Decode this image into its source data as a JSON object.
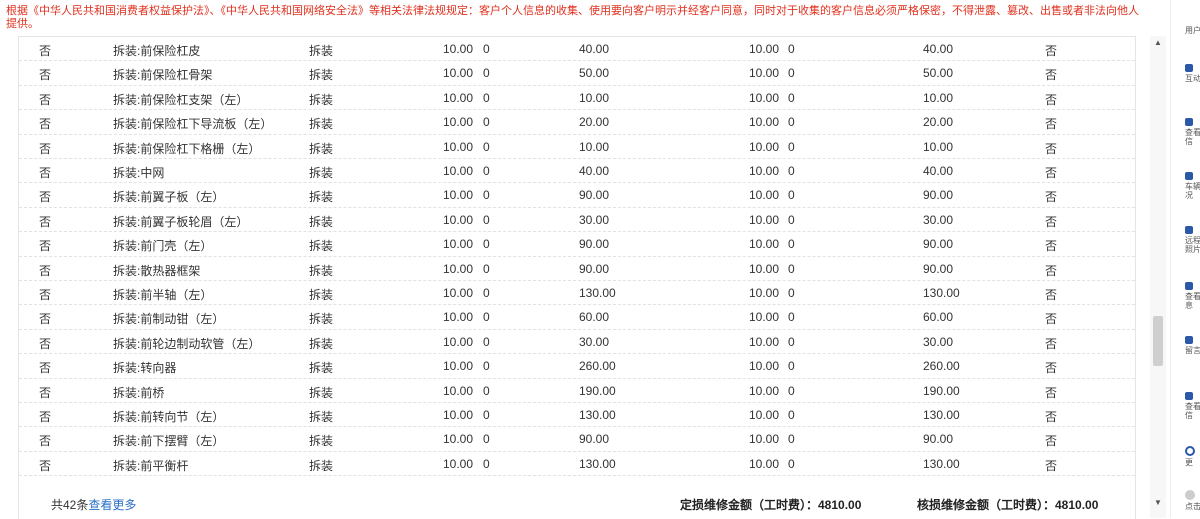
{
  "notice": "根据《中华人民共和国消费者权益保护法》、《中华人民共和国网络安全法》等相关法律法规规定：客户个人信息的收集、使用要向客户明示并经客户同意，同时对于收集的客户信息必须严格保密，不得泄露、篡改、出售或者非法向他人提供。",
  "rows": [
    {
      "flag": "否",
      "name": "拆装:前保险杠皮",
      "type": "拆装",
      "qty": "10.00",
      "z1": "0",
      "amt1": "40.00",
      "qty2": "10.00",
      "z2": "0",
      "amt2": "40.00",
      "flag2": "否"
    },
    {
      "flag": "否",
      "name": "拆装:前保险杠骨架",
      "type": "拆装",
      "qty": "10.00",
      "z1": "0",
      "amt1": "50.00",
      "qty2": "10.00",
      "z2": "0",
      "amt2": "50.00",
      "flag2": "否"
    },
    {
      "flag": "否",
      "name": "拆装:前保险杠支架（左）",
      "type": "拆装",
      "qty": "10.00",
      "z1": "0",
      "amt1": "10.00",
      "qty2": "10.00",
      "z2": "0",
      "amt2": "10.00",
      "flag2": "否"
    },
    {
      "flag": "否",
      "name": "拆装:前保险杠下导流板（左）",
      "type": "拆装",
      "qty": "10.00",
      "z1": "0",
      "amt1": "20.00",
      "qty2": "10.00",
      "z2": "0",
      "amt2": "20.00",
      "flag2": "否"
    },
    {
      "flag": "否",
      "name": "拆装:前保险杠下格栅（左）",
      "type": "拆装",
      "qty": "10.00",
      "z1": "0",
      "amt1": "10.00",
      "qty2": "10.00",
      "z2": "0",
      "amt2": "10.00",
      "flag2": "否"
    },
    {
      "flag": "否",
      "name": "拆装:中网",
      "type": "拆装",
      "qty": "10.00",
      "z1": "0",
      "amt1": "40.00",
      "qty2": "10.00",
      "z2": "0",
      "amt2": "40.00",
      "flag2": "否"
    },
    {
      "flag": "否",
      "name": "拆装:前翼子板（左）",
      "type": "拆装",
      "qty": "10.00",
      "z1": "0",
      "amt1": "90.00",
      "qty2": "10.00",
      "z2": "0",
      "amt2": "90.00",
      "flag2": "否"
    },
    {
      "flag": "否",
      "name": "拆装:前翼子板轮眉（左）",
      "type": "拆装",
      "qty": "10.00",
      "z1": "0",
      "amt1": "30.00",
      "qty2": "10.00",
      "z2": "0",
      "amt2": "30.00",
      "flag2": "否"
    },
    {
      "flag": "否",
      "name": "拆装:前门壳（左）",
      "type": "拆装",
      "qty": "10.00",
      "z1": "0",
      "amt1": "90.00",
      "qty2": "10.00",
      "z2": "0",
      "amt2": "90.00",
      "flag2": "否"
    },
    {
      "flag": "否",
      "name": "拆装:散热器框架",
      "type": "拆装",
      "qty": "10.00",
      "z1": "0",
      "amt1": "90.00",
      "qty2": "10.00",
      "z2": "0",
      "amt2": "90.00",
      "flag2": "否"
    },
    {
      "flag": "否",
      "name": "拆装:前半轴（左）",
      "type": "拆装",
      "qty": "10.00",
      "z1": "0",
      "amt1": "130.00",
      "qty2": "10.00",
      "z2": "0",
      "amt2": "130.00",
      "flag2": "否"
    },
    {
      "flag": "否",
      "name": "拆装:前制动钳（左）",
      "type": "拆装",
      "qty": "10.00",
      "z1": "0",
      "amt1": "60.00",
      "qty2": "10.00",
      "z2": "0",
      "amt2": "60.00",
      "flag2": "否"
    },
    {
      "flag": "否",
      "name": "拆装:前轮边制动软管（左）",
      "type": "拆装",
      "qty": "10.00",
      "z1": "0",
      "amt1": "30.00",
      "qty2": "10.00",
      "z2": "0",
      "amt2": "30.00",
      "flag2": "否"
    },
    {
      "flag": "否",
      "name": "拆装:转向器",
      "type": "拆装",
      "qty": "10.00",
      "z1": "0",
      "amt1": "260.00",
      "qty2": "10.00",
      "z2": "0",
      "amt2": "260.00",
      "flag2": "否"
    },
    {
      "flag": "否",
      "name": "拆装:前桥",
      "type": "拆装",
      "qty": "10.00",
      "z1": "0",
      "amt1": "190.00",
      "qty2": "10.00",
      "z2": "0",
      "amt2": "190.00",
      "flag2": "否"
    },
    {
      "flag": "否",
      "name": "拆装:前转向节（左）",
      "type": "拆装",
      "qty": "10.00",
      "z1": "0",
      "amt1": "130.00",
      "qty2": "10.00",
      "z2": "0",
      "amt2": "130.00",
      "flag2": "否"
    },
    {
      "flag": "否",
      "name": "拆装:前下摆臂（左）",
      "type": "拆装",
      "qty": "10.00",
      "z1": "0",
      "amt1": "90.00",
      "qty2": "10.00",
      "z2": "0",
      "amt2": "90.00",
      "flag2": "否"
    },
    {
      "flag": "否",
      "name": "拆装:前平衡杆",
      "type": "拆装",
      "qty": "10.00",
      "z1": "0",
      "amt1": "130.00",
      "qty2": "10.00",
      "z2": "0",
      "amt2": "130.00",
      "flag2": "否"
    }
  ],
  "footer": {
    "count_prefix": "共42条",
    "more_link": "查看更多",
    "assessed_total": "定损维修金额（工时费）：4810.00",
    "verified_total": "核损维修金额（工时费）：4810.00"
  },
  "scrollbar": {
    "up_icon": "triangle-up",
    "down_icon": "triangle-down"
  },
  "side_panel": [
    {
      "label": "用户",
      "icon": "none"
    },
    {
      "label": "互动",
      "icon": "square"
    },
    {
      "label": "查看信",
      "icon": "square"
    },
    {
      "label": "车辆况",
      "icon": "square"
    },
    {
      "label": "远程照片",
      "icon": "square"
    },
    {
      "label": "查看息",
      "icon": "square"
    },
    {
      "label": "留言",
      "icon": "square"
    },
    {
      "label": "查看信",
      "icon": "square"
    },
    {
      "label": "更",
      "icon": "ring"
    },
    {
      "label": "点击",
      "icon": "dot"
    }
  ],
  "colors": {
    "notice": "#e0301e",
    "link": "#2a6fc9",
    "side_icon": "#2c58a8"
  }
}
